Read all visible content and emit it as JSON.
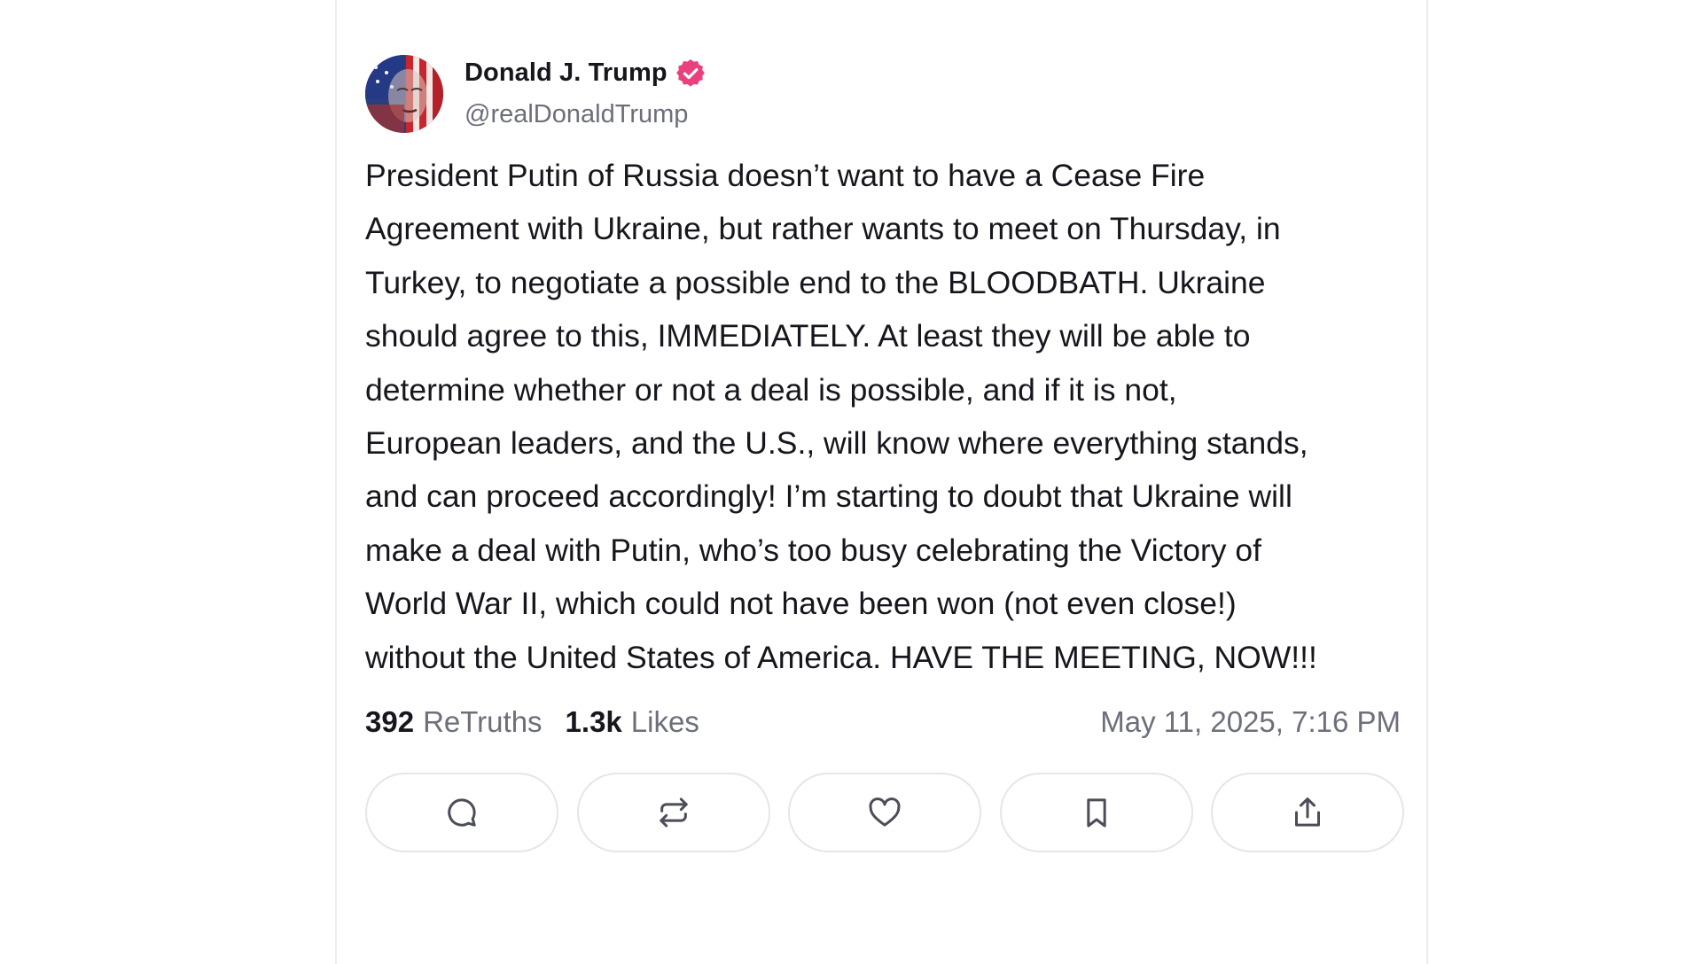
{
  "author": {
    "display_name": "Donald J. Trump",
    "handle": "@realDonaldTrump",
    "verified_icon": "verified-badge-icon",
    "verified_color": "#e8417e"
  },
  "post": {
    "text": "President Putin of Russia doesn’t want to have a Cease Fire\nAgreement with Ukraine, but rather wants to meet on Thursday, in\nTurkey, to negotiate a possible end to the BLOODBATH. Ukraine\nshould agree to this, IMMEDIATELY. At least they will be able to\ndetermine whether or not a deal is possible, and if it is not,\nEuropean leaders, and the U.S., will know where everything stands,\nand can proceed accordingly! I’m starting to doubt that Ukraine will\nmake a deal with Putin, who’s too busy celebrating the Victory of\nWorld War II, which could not have been won (not even close!)\nwithout the United States of America. HAVE THE MEETING, NOW!!!"
  },
  "stats": {
    "retruths_count": "392",
    "retruths_label": "ReTruths",
    "likes_count": "1.3k",
    "likes_label": "Likes",
    "timestamp": "May 11, 2025, 7:16 PM"
  },
  "actions": [
    {
      "icon": "reply-icon"
    },
    {
      "icon": "retruth-icon"
    },
    {
      "icon": "like-heart-icon"
    },
    {
      "icon": "bookmark-icon"
    },
    {
      "icon": "share-icon"
    }
  ],
  "colors": {
    "text": "#16161d",
    "muted": "#6c6f7a",
    "button_border": "#e6e6ea"
  }
}
